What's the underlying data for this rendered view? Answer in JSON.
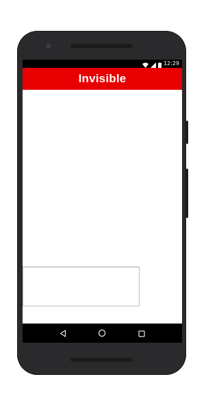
{
  "status_bar": {
    "time": "12:29",
    "icons": [
      "wifi-icon",
      "signal-icon",
      "battery-icon"
    ]
  },
  "app_bar": {
    "title": "Invisible",
    "color": "#e80000"
  },
  "content": {
    "text_box_value": ""
  },
  "nav_bar": {
    "buttons": [
      "back-icon",
      "home-icon",
      "recents-icon"
    ]
  },
  "colors": {
    "phone_body": "#2a2a2c",
    "accent": "#e80000"
  }
}
